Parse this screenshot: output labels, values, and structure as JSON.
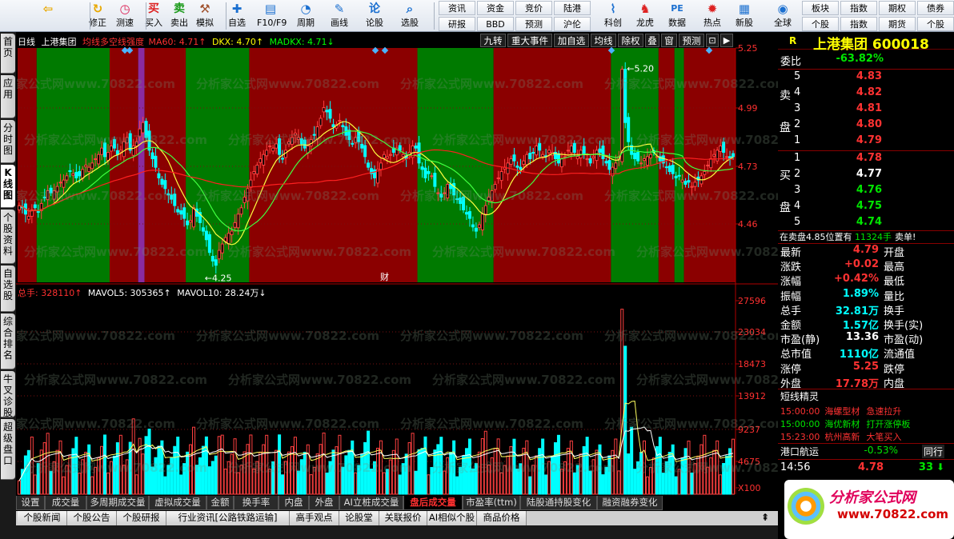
{
  "toolbar": {
    "buttons": [
      {
        "id": "back",
        "label": "",
        "icon": "back-arrow-icon"
      },
      {
        "id": "refresh",
        "label": "修正",
        "icon": "refresh-icon"
      },
      {
        "id": "measure",
        "label": "测速",
        "icon": "clock-icon"
      },
      {
        "id": "buy",
        "label": "买入",
        "icon": "buy-icon",
        "glyph": "买"
      },
      {
        "id": "sell",
        "label": "卖出",
        "icon": "sell-icon",
        "glyph": "卖"
      },
      {
        "id": "simulate",
        "label": "模拟",
        "icon": "gavel-icon"
      },
      {
        "id": "watchlist",
        "label": "自选",
        "icon": "plus-icon"
      },
      {
        "id": "f10",
        "label": "F10/F9",
        "icon": "f10-icon"
      },
      {
        "id": "cycle",
        "label": "周期",
        "icon": "cycle-icon"
      },
      {
        "id": "draw",
        "label": "画线",
        "icon": "pen-icon"
      },
      {
        "id": "stock_talk",
        "label": "论股",
        "icon": "talk-icon",
        "glyph": "论"
      },
      {
        "id": "pick",
        "label": "选股",
        "icon": "search-icon"
      }
    ],
    "grid": [
      [
        "资讯",
        "资金",
        "竞价",
        "陆港"
      ],
      [
        "研报",
        "BBD",
        "预测",
        "沪伦"
      ]
    ],
    "buttons2": [
      {
        "id": "tech",
        "label": "科创",
        "icon": "chart-icon"
      },
      {
        "id": "dragon",
        "label": "龙虎",
        "icon": "dragon-icon"
      },
      {
        "id": "data",
        "label": "数据",
        "icon": "pe-icon",
        "glyph": "PE"
      },
      {
        "id": "hot",
        "label": "热点",
        "icon": "hot-icon"
      },
      {
        "id": "newstock",
        "label": "新股",
        "icon": "newstock-icon"
      },
      {
        "id": "global",
        "label": "全球",
        "icon": "globe-icon"
      }
    ],
    "grid2": [
      [
        "板块",
        "指数",
        "期权",
        "债券"
      ],
      [
        "个股",
        "指数",
        "期货",
        "个股"
      ]
    ]
  },
  "left_tabs": [
    "首页",
    "应用",
    "分时图",
    "K线图",
    "个股资料",
    "自选股",
    "综合排名",
    "牛叉诊股",
    "超级盘口"
  ],
  "chart_header": {
    "period": "日线",
    "name": "上港集团",
    "indicator": "均线多空线强度",
    "ma60": "MA60: 4.71↑",
    "dkx": "DKX: 4.70↑",
    "madkx": "MADKX: 4.71↓"
  },
  "chart_buttons": [
    "九转",
    "重大事件",
    "加自选",
    "均线",
    "除权",
    "叠",
    "窗",
    "预测"
  ],
  "price_axis": [
    "5.25",
    "4.99",
    "4.73",
    "4.46"
  ],
  "vol_axis": [
    "27596",
    "23034",
    "18473",
    "13912",
    "9237",
    "4675",
    "X100"
  ],
  "annotations": {
    "high": "5.20",
    "low": "4.25",
    "fin": "财"
  },
  "vol_header": {
    "total": "总手: 328110↑",
    "mavol5": "MAVOL5: 305365↑",
    "mavol10": "MAVOL10: 28.24万↓"
  },
  "bottom_tabs": [
    "设置",
    "成交量",
    "多周期成交量",
    "虚拟成交量",
    "金额",
    "换手率",
    "内盘",
    "外盘",
    "AI立桩成交量",
    "盘后成交量",
    "市盈率(ttm)",
    "陆股通持股变化",
    "融资融券变化"
  ],
  "status_tabs": [
    "个股新闻",
    "个股公告",
    "个股研报",
    "行业资讯[公路铁路运输]",
    "高手观点",
    "论股堂",
    "关联报价",
    "AI相似个股",
    "商品价格"
  ],
  "watermark": "分析家公式网www.70822.com",
  "quote": {
    "badge": "R",
    "name": "上港集团",
    "code": "600018",
    "ratio_label": "委比",
    "ratio": "-63.82%",
    "sell_label": "卖盘",
    "buy_label": "买盘",
    "asks": [
      {
        "lvl": "5",
        "price": "4.83"
      },
      {
        "lvl": "4",
        "price": "4.82"
      },
      {
        "lvl": "3",
        "price": "4.81"
      },
      {
        "lvl": "2",
        "price": "4.80"
      },
      {
        "lvl": "1",
        "price": "4.79"
      }
    ],
    "bids": [
      {
        "lvl": "1",
        "price": "4.78"
      },
      {
        "lvl": "2",
        "price": "4.77"
      },
      {
        "lvl": "3",
        "price": "4.76"
      },
      {
        "lvl": "4",
        "price": "4.75"
      },
      {
        "lvl": "5",
        "price": "4.74"
      }
    ],
    "bigorder": "在卖盘4.85位置有",
    "bigorder_qty": "11324手",
    "bigorder_tag": "卖单!",
    "stats": [
      {
        "l": "最新",
        "v": "4.79",
        "l2": "开盘",
        "c": "red"
      },
      {
        "l": "涨跌",
        "v": "+0.02",
        "l2": "最高",
        "c": "red"
      },
      {
        "l": "涨幅",
        "v": "+0.42%",
        "l2": "最低",
        "c": "red"
      },
      {
        "l": "振幅",
        "v": "1.89%",
        "l2": "量比",
        "c": "cya"
      },
      {
        "l": "总手",
        "v": "32.81万",
        "l2": "换手",
        "c": "cya"
      },
      {
        "l": "金额",
        "v": "1.57亿",
        "l2": "换手(实)",
        "c": "cya"
      },
      {
        "l": "市盈(静)",
        "v": "13.36",
        "l2": "市盈(动)",
        "c": "wht"
      },
      {
        "l": "总市值",
        "v": "1110亿",
        "l2": "流通值",
        "c": "cya"
      },
      {
        "l": "涨停",
        "v": "5.25",
        "l2": "跌停",
        "c": "red"
      },
      {
        "l": "外盘",
        "v": "17.78万",
        "l2": "内盘",
        "c": "red"
      }
    ],
    "elf_title": "短线精灵",
    "elf": [
      {
        "t": "15:00:00",
        "n": "海螺型材",
        "e": "急速拉升",
        "c": "red"
      },
      {
        "t": "15:00:00",
        "n": "海优新材",
        "e": "打开涨停板",
        "c": "grn"
      },
      {
        "t": "15:23:00",
        "n": "杭州高新",
        "e": "大笔买入",
        "c": "red"
      }
    ],
    "index_name": "港口航运",
    "index_chg": "-0.53%",
    "index_tab": "同行",
    "tick_time": "14:56",
    "tick_price": "4.78",
    "tick_vol": "33",
    "logo_text": "分析家公式网",
    "logo_url": "www.70822.com"
  },
  "chart_data": {
    "type": "candlestick",
    "y_price_range": [
      4.2,
      5.3
    ],
    "y_vol_range": [
      0,
      29000
    ],
    "bands": [
      [
        "red",
        0,
        6
      ],
      [
        "green",
        6,
        29
      ],
      [
        "red",
        29,
        38
      ],
      [
        "purple",
        38,
        40
      ],
      [
        "red",
        40,
        53
      ],
      [
        "green",
        53,
        73
      ],
      [
        "red",
        73,
        126
      ],
      [
        "green",
        126,
        150
      ],
      [
        "red",
        150,
        187
      ],
      [
        "green",
        187,
        202
      ],
      [
        "red",
        202,
        207
      ],
      [
        "green",
        207,
        210
      ],
      [
        "red",
        210,
        233
      ],
      [
        "green",
        233,
        246
      ],
      [
        "red",
        246,
        255
      ]
    ],
    "price": [
      4.56,
      4.55,
      4.52,
      4.51,
      4.54,
      4.55,
      4.53,
      4.57,
      4.6,
      4.63,
      4.62,
      4.63,
      4.65,
      4.67,
      4.68,
      4.7,
      4.72,
      4.71,
      4.69,
      4.7,
      4.73,
      4.75,
      4.74,
      4.76,
      4.78,
      4.8,
      4.83,
      4.79,
      4.81,
      4.84,
      4.83,
      4.8,
      4.82,
      4.86,
      4.88,
      4.82,
      4.84,
      4.86,
      4.92,
      4.95,
      4.88,
      4.82,
      4.78,
      4.74,
      4.69,
      4.66,
      4.64,
      4.61,
      4.59,
      4.56,
      4.53,
      4.52,
      4.5,
      4.47,
      4.49,
      4.55,
      4.51,
      4.48,
      4.44,
      4.4,
      4.34,
      4.3,
      4.28,
      4.35,
      4.38,
      4.41,
      4.43,
      4.44,
      4.48,
      4.52,
      4.55,
      4.6,
      4.64,
      4.68,
      4.72,
      4.75,
      4.78,
      4.8,
      4.82,
      4.84,
      4.83,
      4.85,
      4.8,
      4.78,
      4.82,
      4.86,
      4.88,
      4.9,
      4.88,
      4.85,
      4.83,
      4.84,
      4.87,
      4.89,
      4.93,
      4.97,
      5.02,
      5.0,
      4.97,
      4.93,
      4.94,
      4.96,
      4.93,
      4.89,
      4.87,
      4.85,
      4.88,
      4.86,
      4.83,
      4.79,
      4.74,
      4.71,
      4.69,
      4.73,
      4.76,
      4.8,
      4.79,
      4.8,
      4.81,
      4.83,
      4.82,
      4.8,
      4.78,
      4.81,
      4.84,
      4.83,
      4.76,
      4.73,
      4.69,
      4.71,
      4.7,
      4.65,
      4.62,
      4.6,
      4.62,
      4.66,
      4.64,
      4.61,
      4.59,
      4.57,
      4.54,
      4.52,
      4.5,
      4.46,
      4.44,
      4.47,
      4.52,
      4.56,
      4.6,
      4.63,
      4.66,
      4.69,
      4.72,
      4.74,
      4.76,
      4.78,
      4.77,
      4.74,
      4.73,
      4.77,
      4.8,
      4.78,
      4.81,
      4.84,
      4.82,
      4.8,
      4.79,
      4.82,
      4.81,
      4.78,
      4.76,
      4.78,
      4.79,
      4.82,
      4.84,
      4.81,
      4.79,
      4.82,
      4.8,
      4.78,
      4.76,
      4.79,
      4.82,
      4.81,
      4.78,
      4.76,
      4.73,
      4.74,
      4.76,
      4.79,
      5.2,
      4.95,
      4.86,
      4.8,
      4.78,
      4.77,
      4.76,
      4.78,
      4.79,
      4.8,
      4.81,
      4.79,
      4.77,
      4.76,
      4.74,
      4.72,
      4.71,
      4.69,
      4.7,
      4.68,
      4.66,
      4.67,
      4.65,
      4.67,
      4.68,
      4.7,
      4.72,
      4.75,
      4.78,
      4.8,
      4.82,
      4.84,
      4.81,
      4.79,
      4.78,
      4.79
    ]
  }
}
